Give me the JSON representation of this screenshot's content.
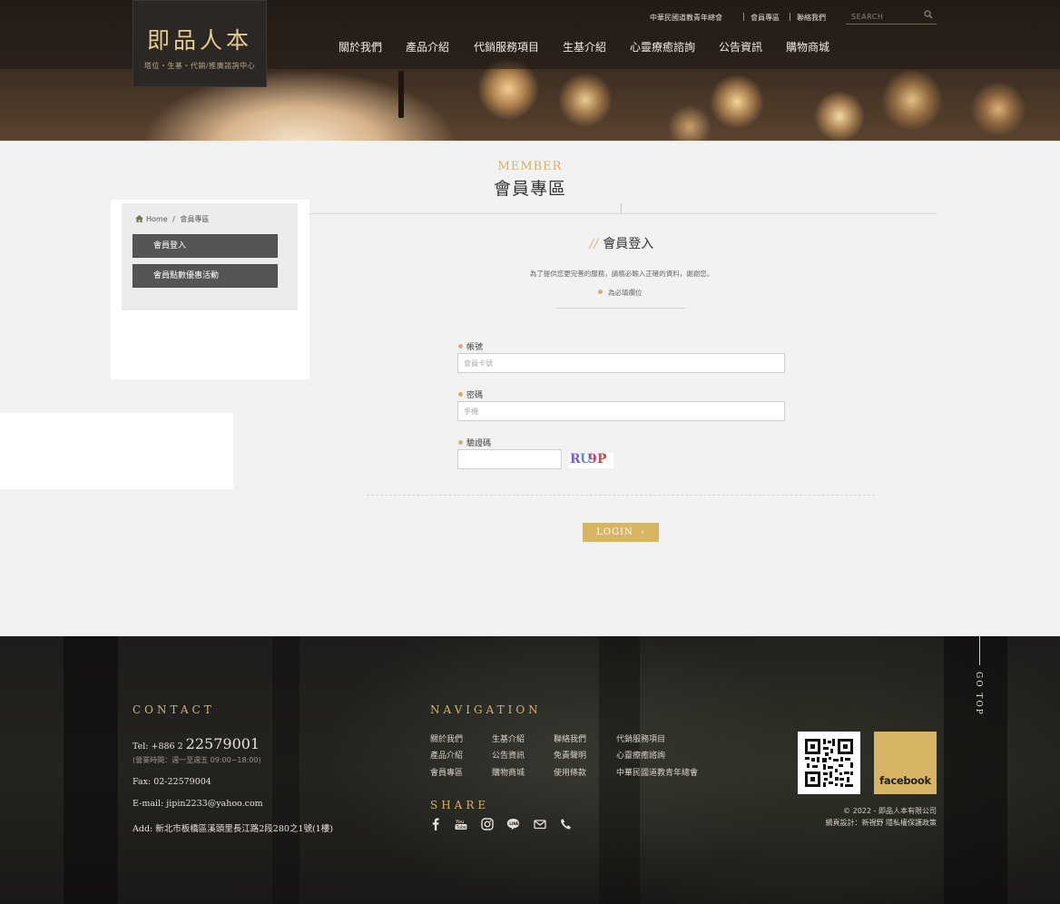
{
  "brand": {
    "name": "即品人本",
    "tagline": "塔位・生基・代銷/推廣諮詢中心"
  },
  "utility": {
    "links": [
      "中華民國道教青年總會",
      "會員專區",
      "聯絡我們"
    ],
    "search_placeholder": "SEARCH"
  },
  "nav": [
    "關於我們",
    "產品介紹",
    "代銷服務項目",
    "生基介紹",
    "心靈療癒諮詢",
    "公告資訊",
    "購物商城"
  ],
  "page": {
    "subtitle": "MEMBER",
    "title": "會員專區"
  },
  "breadcrumb": {
    "home": "Home",
    "sep": "/",
    "current": "會員專區"
  },
  "sidebar": {
    "items": [
      "會員登入",
      "會員點數優惠活動"
    ]
  },
  "login": {
    "heading_mark": "//",
    "heading": "會員登入",
    "notice": "為了提供您更完善的服務，請務必輸入正確的資料，謝謝您。",
    "required_note": "為必填欄位",
    "fields": [
      {
        "label": "帳號",
        "placeholder": "會員卡號"
      },
      {
        "label": "密碼",
        "placeholder": "手機"
      },
      {
        "label": "驗證碼"
      }
    ],
    "captcha": [
      "R",
      "U",
      "9",
      "P"
    ],
    "submit": "LOGIN"
  },
  "footer": {
    "contact_heading": "CONTACT",
    "tel_prefix": "Tel: +886 2",
    "tel_number": "22579001",
    "hours": "(營業時間：週一至週五 09:00~18:00)",
    "fax": "Fax: 02-22579004",
    "email": "E-mail: jipin2233@yahoo.com",
    "address": "Add: 新北市板橋區溪頭里長江路2段280之1號(1樓)",
    "nav_heading": "NAVIGATION",
    "nav_links": [
      [
        "關於我們",
        "生基介紹",
        "聯絡我們",
        "代銷服務項目"
      ],
      [
        "產品介紹",
        "公告資訊",
        "免責聲明",
        "心靈療癒諮詢"
      ],
      [
        "會員專區",
        "購物商城",
        "使用條款",
        "中華民國道教青年總會"
      ]
    ],
    "share_heading": "SHARE",
    "share_icons": [
      "facebook-icon",
      "youtube-icon",
      "instagram-icon",
      "line-icon",
      "mail-icon",
      "phone-icon"
    ],
    "facebook_label": "facebook",
    "copyright": "© 2022 - 即品人本有限公司",
    "credit": "網頁設計：新視野 隱私權保護政策",
    "go_top": "GO TOP"
  },
  "colors": {
    "accent": "#d6b06a",
    "button": "#d8b565",
    "sidebar_button": "#555555",
    "bg": "#f2f2f2"
  }
}
